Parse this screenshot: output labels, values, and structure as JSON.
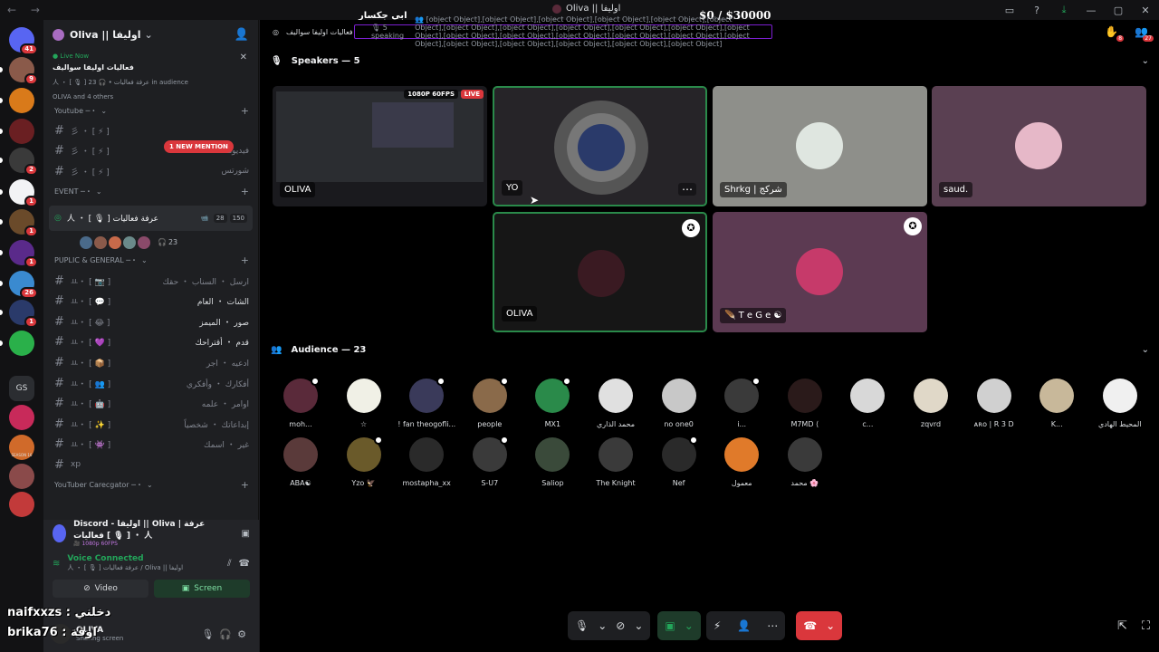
{
  "window": {
    "title": "Oliva || اوليفا",
    "money_overlay": "$0   / $30000",
    "nav_icons": "←  →",
    "controls": [
      "monitor-icon",
      "help-icon",
      "download-icon",
      "minimize-icon",
      "maximize-icon",
      "close-icon"
    ]
  },
  "overlays": {
    "top_name": "ابي جكسار",
    "bottom_line1": "naifxxzs : دخلني",
    "bottom_line2": "brika76 : اوقة"
  },
  "server_rail": {
    "items": [
      {
        "badge": "41",
        "color": "#5865f2"
      },
      {
        "badge": "9",
        "color": "#8a5a4a"
      },
      {
        "badge": "",
        "color": "#d97a1a"
      },
      {
        "badge": "",
        "color": "#6a1f22"
      },
      {
        "badge": "2",
        "color": "#3a3a3a"
      },
      {
        "badge": "1",
        "color": "#f2f3f5"
      },
      {
        "badge": "1",
        "color": "#6a4a2a"
      },
      {
        "badge": "1",
        "color": "#5a2a8a"
      },
      {
        "badge": "26",
        "color": "#3a8ad0"
      },
      {
        "badge": "1",
        "color": "#2a3a6a"
      },
      {
        "badge": "",
        "color": "#2ab04a"
      },
      {
        "badge": "",
        "color": "#2b2d31",
        "text": "GS"
      },
      {
        "badge": "",
        "color": "#c82a5a"
      },
      {
        "badge": "",
        "color": "#d06a2a",
        "text": "SEASON 16"
      },
      {
        "badge": "",
        "color": "#8a4a4a"
      },
      {
        "badge": "",
        "color": "#c23a3a"
      }
    ]
  },
  "sidebar": {
    "guild_name": "Oliva || اوليفا",
    "live": {
      "tag": "Live Now",
      "event_name": "فعاليات اوليفا سواليف",
      "sub": "人 ・ [ 🎙 ] عرفة فعاليات  •  🎧 23 in audience",
      "people": "OLIVA and 4 others"
    },
    "mention_pill": "1 NEW MENTION",
    "categories": [
      {
        "title": "Youtube ─・",
        "channels": [
          {
            "prefix": "彡 ・ [ ⚡ ]",
            "name": "",
            "bright": false
          },
          {
            "prefix": "彡 ・ [ ⚡ ]",
            "name": "فيديوهات",
            "bright": false
          },
          {
            "prefix": "彡 ・ [ ⚡ ]",
            "name": "شورتس",
            "bright": false
          }
        ]
      },
      {
        "title": "EVENT ─・",
        "voice": {
          "name": "人 ・ [ 🎙 ] عرفة فعاليات",
          "sub": "فعاليات اوليفا سواليف",
          "video": "28",
          "limit": "150",
          "audience": "23"
        }
      },
      {
        "title": "PUPLIC & GENERAL ─・",
        "channels": [
          {
            "prefix": "ㅛ・ [ 📷 ]",
            "name": "ارسل ・ السناب ・ حقك",
            "bright": false
          },
          {
            "prefix": "ㅛ・ [ 💬 ]",
            "name": "الشات ・ العام",
            "bright": true
          },
          {
            "prefix": "ㅛ・ [ 😂 ]",
            "name": "صور ・ الميمز",
            "bright": true
          },
          {
            "prefix": "ㅛ・ [ 💜 ]",
            "name": "قدم ・ أقتراحك",
            "bright": true
          },
          {
            "prefix": "ㅛ・ [ 📦 ]",
            "name": "ادعيه ・ اجر",
            "bright": false
          },
          {
            "prefix": "ㅛ・ [ 👥 ]",
            "name": "أفكارك ・ وأفكري",
            "bright": false
          },
          {
            "prefix": "ㅛ・ [ 🤖 ]",
            "name": "اوامر ・ علمه",
            "bright": false
          },
          {
            "prefix": "ㅛ・ [ ✨ ]",
            "name": "إبداعاتك ・ شخصياً",
            "bright": false
          },
          {
            "prefix": "ㅛ・ [ 👾 ]",
            "name": "غير ・ اسمك",
            "bright": false
          },
          {
            "prefix": "",
            "name": "xp",
            "bright": false
          }
        ]
      },
      {
        "title": "YouTuber Carecgator ─・",
        "channels": []
      }
    ]
  },
  "rtc": {
    "activity_title": "Discord - اوليفا || Oliva | عرفة فعاليات [ 🎙 ] ・ 人",
    "activity_sub": "🎥 1080p 60FPS",
    "voice_connected": "Voice Connected",
    "voice_sub": "人 ・ [ 🎙 ] عرفة فعاليات / Oliva || اوليفا",
    "video_label": "Video",
    "screen_label": "Screen",
    "user_name": "OLIVA",
    "user_status": "Sharing screen"
  },
  "stage": {
    "title": "فعاليات اوليفا سواليف",
    "speaking": "5 speaking",
    "audience": [
      {
        "name": "moh...",
        "color": "#5a2a3a",
        "mod": true
      },
      {
        "name": "☆",
        "color": "#f0f0e6",
        "mod": false
      },
      {
        "name": "! fan theogofli...",
        "color": "#3a3a5a",
        "mod": true
      },
      {
        "name": "people",
        "color": "#8a6a4a",
        "mod": true
      },
      {
        "name": "MX1",
        "color": "#2a8a4a",
        "mod": true
      },
      {
        "name": "محمد الذاري",
        "color": "#e0e0e0",
        "mod": false
      },
      {
        "name": "no one0",
        "color": "#c8c8c8",
        "mod": false
      },
      {
        "name": "i...",
        "color": "#3a3a3a",
        "mod": true
      },
      {
        "name": "M7MD ⟨",
        "color": "#2a1a1a",
        "mod": false
      },
      {
        "name": "c...",
        "color": "#d8d8d8",
        "mod": false
      },
      {
        "name": "zqvrd",
        "color": "#e0d8c8",
        "mod": false
      },
      {
        "name": "ᴀʀᴏ | R 3 D",
        "color": "#d0d0d0",
        "mod": false
      },
      {
        "name": "K...",
        "color": "#c8b89a",
        "mod": false
      },
      {
        "name": "المحيط الهادي",
        "color": "#f0f0f0",
        "mod": false
      },
      {
        "name": "ABA☯",
        "color": "#5a3a3a",
        "mod": false
      },
      {
        "name": "Yzo 🦅",
        "color": "#6a5a2a",
        "mod": true
      },
      {
        "name": "mostapha_xx",
        "color": "#2a2a2a",
        "mod": false
      },
      {
        "name": "S-U7",
        "color": "#3a3a3a",
        "mod": true
      },
      {
        "name": "Saliop",
        "color": "#3a4a3a",
        "mod": false
      },
      {
        "name": "The Knight",
        "color": "#3a3a3a",
        "mod": false
      },
      {
        "name": "Nef",
        "color": "#2a2a2a",
        "mod": true
      },
      {
        "name": "معمول",
        "color": "#e07a2a",
        "mod": false
      },
      {
        "name": "محمد 🌸",
        "color": "#3a3a3a",
        "mod": false
      }
    ],
    "hand_badge": "8",
    "users_badge": "27",
    "speakers_title": "Speakers — 5",
    "audience_title": "Audience — 23",
    "speakers": [
      {
        "name": "OLIVA",
        "bg": "#1a1a1e",
        "stream": true,
        "fps": "1080P 60FPS",
        "live": "LIVE",
        "speaking": false,
        "mod": false
      },
      {
        "name": "YO",
        "bg": "#262428",
        "stream": false,
        "speaking": true,
        "mod": false,
        "avatar": "#2a3a6a"
      },
      {
        "name": "Shrkg | شركج",
        "bg": "#8e8f8a",
        "stream": false,
        "speaking": false,
        "mod": false,
        "avatar": "#dfe6e0"
      },
      {
        "name": "saud.",
        "bg": "#5a4052",
        "stream": false,
        "speaking": false,
        "mod": false,
        "avatar": "#e6b8c8"
      },
      {
        "name": "OLIVA",
        "bg": "#161616",
        "stream": false,
        "speaking": true,
        "mod": true,
        "avatar": "#3a1a22"
      },
      {
        "name": "🪶 T e G e ☯",
        "bg": "#5c3a52",
        "stream": false,
        "speaking": false,
        "mod": true,
        "avatar": "#c63a6a"
      }
    ]
  },
  "controls": {
    "icons": [
      "mic-icon",
      "camera-off-icon",
      "screen-share-icon",
      "activity-off-icon",
      "add-user-icon",
      "more-icon",
      "leave-call-icon"
    ]
  }
}
